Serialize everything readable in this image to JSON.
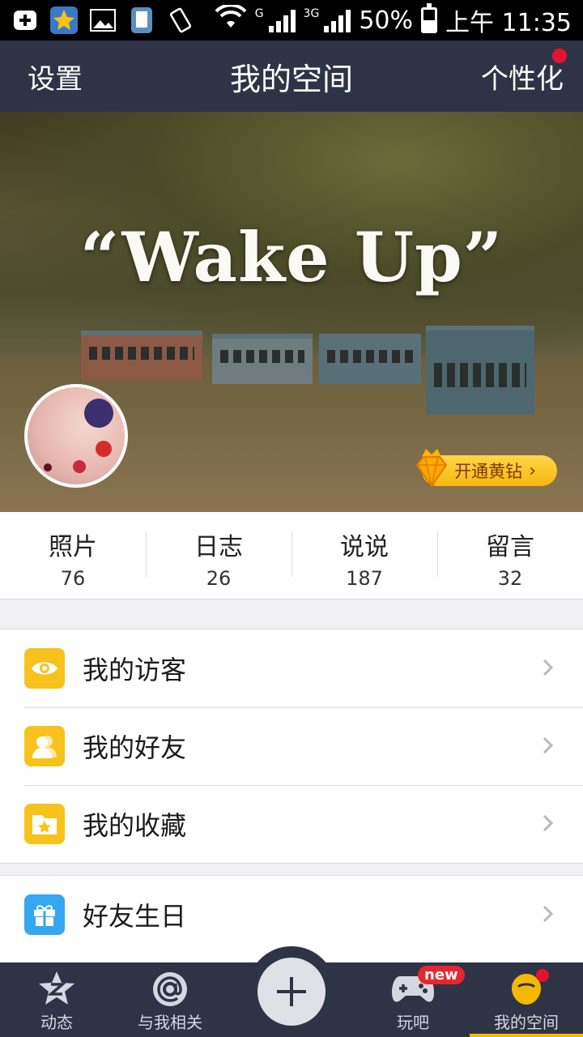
{
  "status_bar": {
    "network_g": "G",
    "network_3g": "3G",
    "battery": "50%",
    "time": "上午 11:35"
  },
  "header": {
    "left": "设置",
    "title": "我的空间",
    "right": "个性化"
  },
  "cover": {
    "title": "“Wake Up”",
    "vip_button": "开通黄钻"
  },
  "stats": [
    {
      "label": "照片",
      "value": "76"
    },
    {
      "label": "日志",
      "value": "26"
    },
    {
      "label": "说说",
      "value": "187"
    },
    {
      "label": "留言",
      "value": "32"
    }
  ],
  "menu": {
    "group1": [
      {
        "label": "我的访客",
        "icon": "eye-icon",
        "color": "#f8c21d"
      },
      {
        "label": "我的好友",
        "icon": "friend-icon",
        "color": "#f8c21d"
      },
      {
        "label": "我的收藏",
        "icon": "folder-star-icon",
        "color": "#f8c21d"
      }
    ],
    "group2": [
      {
        "label": "好友生日",
        "icon": "gift-icon",
        "color": "#34a6f2"
      }
    ]
  },
  "tabbar": {
    "items": [
      {
        "label": "动态"
      },
      {
        "label": "与我相关"
      },
      {
        "label": "玩吧",
        "badge": "new"
      },
      {
        "label": "我的空间"
      }
    ]
  },
  "colors": {
    "header_bg": "#2e3445",
    "accent_yellow": "#f8c21d",
    "accent_blue": "#34a6f2",
    "badge_red": "#e8112d"
  }
}
